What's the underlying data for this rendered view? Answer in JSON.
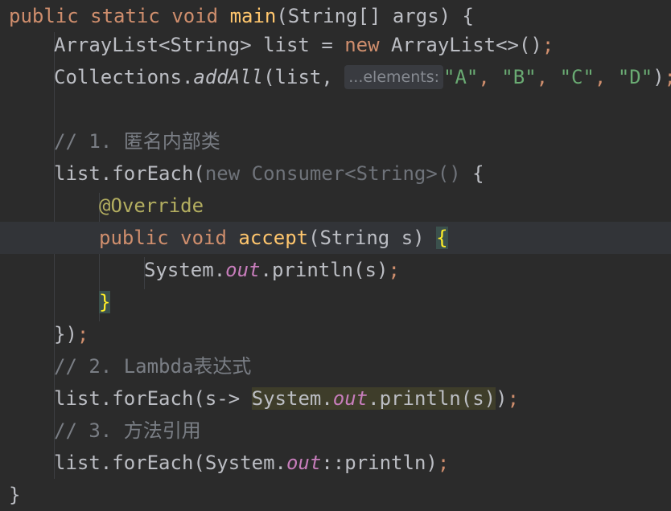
{
  "code": {
    "l1": {
      "kw1": "public",
      "kw2": "static",
      "kw3": "void",
      "fn": "main",
      "rest": "(String[] args) {"
    },
    "l2": {
      "pre": "ArrayList<String> list = ",
      "kw": "new",
      "post": " ArrayList<>()",
      "semi": ";"
    },
    "l3": {
      "cls": "Collections.",
      "method": "addAll",
      "open": "(list, ",
      "hint": "...elements:",
      "s1": "\"A\"",
      "c1": ", ",
      "s2": "\"B\"",
      "c2": ", ",
      "s3": "\"C\"",
      "c3": ", ",
      "s4": "\"D\"",
      "close": ")",
      "semi": ";"
    },
    "l5": {
      "comment": "// 1. 匿名内部类"
    },
    "l6": {
      "pre": "list.forEach(",
      "muted": "new Consumer<String>()",
      "post": " {"
    },
    "l7": {
      "annotation": "@Override"
    },
    "l8": {
      "kw1": "public",
      "kw2": "void",
      "fn": "accept",
      "args": "(String s) ",
      "brace": "{"
    },
    "l9": {
      "cls": "System.",
      "field": "out",
      "call": ".println(s)",
      "semi": ";"
    },
    "l10": {
      "brace": "}"
    },
    "l11": {
      "close": "})",
      "semi": ";"
    },
    "l12": {
      "comment": "// 2. Lambda表达式"
    },
    "l13": {
      "pre": "list.forEach(s-> ",
      "hl_cls": "System.",
      "hl_field": "out",
      "hl_call": ".println(s)",
      "post": ")",
      "semi": ";"
    },
    "l14": {
      "comment": "// 3. 方法引用"
    },
    "l15": {
      "pre": "list.forEach(System.",
      "field": "out",
      "post": "::println)",
      "semi": ";"
    },
    "l16": {
      "brace": "}"
    }
  }
}
